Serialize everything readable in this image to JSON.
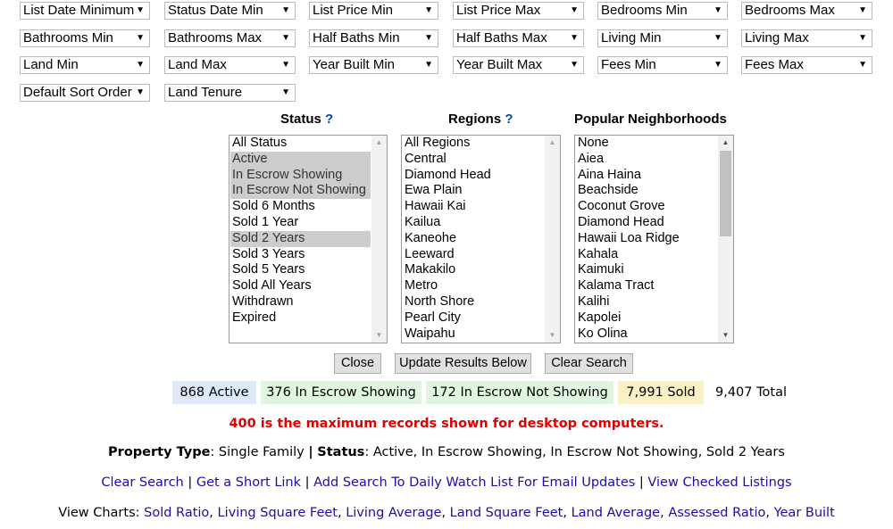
{
  "filters": [
    "List Date Minimum",
    "Status Date Min",
    "List Price Min",
    "List Price Max",
    "Bedrooms Min",
    "Bedrooms Max",
    "Bathrooms Min",
    "Bathrooms Max",
    "Half Baths Min",
    "Half Baths Max",
    "Living Min",
    "Living Max",
    "Land Min",
    "Land Max",
    "Year Built Min",
    "Year Built Max",
    "Fees Min",
    "Fees Max",
    "Default Sort Order",
    "Land Tenure"
  ],
  "help_mark": "?",
  "status": {
    "header": "Status",
    "options": [
      "All Status",
      "Active",
      "In Escrow Showing",
      "In Escrow Not Showing",
      "Sold 6 Months",
      "Sold 1 Year",
      "Sold 2 Years",
      "Sold 3 Years",
      "Sold 5 Years",
      "Sold All Years",
      "Withdrawn",
      "Expired"
    ],
    "selected": [
      "Active",
      "In Escrow Showing",
      "In Escrow Not Showing",
      "Sold 2 Years"
    ]
  },
  "regions": {
    "header": "Regions",
    "options": [
      "All Regions",
      "Central",
      "Diamond Head",
      "Ewa Plain",
      "Hawaii Kai",
      "Kailua",
      "Kaneohe",
      "Leeward",
      "Makakilo",
      "Metro",
      "North Shore",
      "Pearl City",
      "Waipahu"
    ]
  },
  "neighborhoods": {
    "header": "Popular Neighborhoods",
    "options": [
      "None",
      "Aiea",
      "Aina Haina",
      "Beachside",
      "Coconut Grove",
      "Diamond Head",
      "Hawaii Loa Ridge",
      "Kahala",
      "Kaimuki",
      "Kalama Tract",
      "Kalihi",
      "Kapolei",
      "Ko Olina"
    ]
  },
  "buttons": {
    "close": "Close",
    "update": "Update Results Below",
    "clear": "Clear Search"
  },
  "counts": {
    "active": "868 Active",
    "escrow_showing": "376 In Escrow Showing",
    "escrow_not_showing": "172 In Escrow Not Showing",
    "sold": "7,991 Sold",
    "total": "9,407 Total"
  },
  "colors": {
    "active": "#dde8f8",
    "escrow": "#e0f6e0",
    "sold": "#fbf0c4",
    "link": "#1a0dab",
    "warning": "#e00000"
  },
  "warning": "400 is the maximum records shown for desktop computers.",
  "summary": {
    "type_label": "Property Type",
    "type_value": ": Single Family ",
    "sep": "|",
    "status_label": "Status",
    "status_value": ": Active, In Escrow Showing, In Escrow Not Showing, Sold 2 Years"
  },
  "links": {
    "clear_search": "Clear Search",
    "short_link": "Get a Short Link",
    "watch_list": "Add Search To Daily Watch List For Email Updates",
    "checked": "View Checked Listings",
    "sep": " | "
  },
  "charts": {
    "label": "View Charts: ",
    "items": [
      "Sold Ratio",
      "Living Square Feet",
      "Living Average",
      "Land Square Feet",
      "Land Average",
      "Assessed Ratio",
      "Year Built"
    ]
  }
}
